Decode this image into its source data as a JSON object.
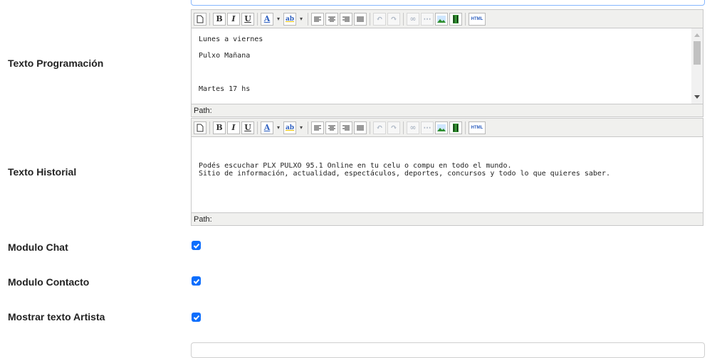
{
  "labels": {
    "programacion": "Texto Programación",
    "historial": "Texto Historial",
    "chat": "Modulo Chat",
    "contacto": "Modulo Contacto",
    "artista": "Mostrar texto Artista"
  },
  "editor_programacion": {
    "lines": [
      "Lunes a viernes",
      "Pulxo Mañana",
      "",
      "",
      "Martes 17 hs"
    ],
    "path_label": "Path:"
  },
  "editor_historial": {
    "lines": [
      "Podés escuchar PLX PULXO 95.1 Online en tu celu o compu en todo el mundo.",
      "Sitio de información, actualidad, espectáculos, deportes, concursos y todo lo que quieres saber."
    ],
    "path_label": "Path:"
  },
  "toolbar": {
    "new_doc_icon": "new-document-icon",
    "bold": "B",
    "italic": "I",
    "underline": "U",
    "font_color": "A",
    "highlight": "ab",
    "html": "HTML"
  },
  "checkboxes": {
    "chat_checked": true,
    "contacto_checked": true,
    "artista_checked": true
  },
  "colors": {
    "checkbox": "#0d6efd",
    "toolbar_bg": "#f0f0ee"
  }
}
